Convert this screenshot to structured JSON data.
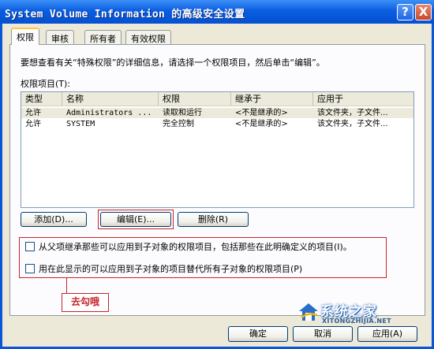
{
  "window": {
    "title": "System Volume Information 的高级安全设置",
    "help_label": "?",
    "close_label": "X"
  },
  "tabs": [
    {
      "label": "权限",
      "active": true
    },
    {
      "label": "审核",
      "active": false
    },
    {
      "label": "所有者",
      "active": false
    },
    {
      "label": "有效权限",
      "active": false
    }
  ],
  "info_text": "要想查看有关“特殊权限”的详细信息，请选择一个权限项目，然后单击“编辑”。",
  "permission_entries_label": "权限项目(T):",
  "table": {
    "columns": [
      "类型",
      "名称",
      "权限",
      "继承于",
      "应用于"
    ],
    "rows": [
      {
        "type": "允许",
        "name": "Administrators ...",
        "permission": "读取和运行",
        "inherited_from": "<不是继承的>",
        "apply_to": "该文件夹，子文件..."
      },
      {
        "type": "允许",
        "name": "SYSTEM",
        "permission": "完全控制",
        "inherited_from": "<不是继承的>",
        "apply_to": "该文件夹，子文件..."
      }
    ]
  },
  "buttons": {
    "add": "添加(D)...",
    "edit": "编辑(E)...",
    "remove": "删除(R)",
    "ok": "确定",
    "cancel": "取消",
    "apply": "应用(A)"
  },
  "checkboxes": [
    {
      "label": "从父项继承那些可以应用到子对象的权限项目，包括那些在此明确定义的项目(I)。",
      "checked": false
    },
    {
      "label": "用在此显示的可以应用到子对象的项目替代所有子对象的权限项目(P)",
      "checked": false
    }
  ],
  "annotation": "去勾哦",
  "watermark": {
    "text": "系统之家",
    "url": "XITONGZHIJIA.NET"
  },
  "colors": {
    "titlebar": "#0a5ee0",
    "annotation_red": "#c8242a",
    "tab_highlight": "#ffc83c"
  }
}
